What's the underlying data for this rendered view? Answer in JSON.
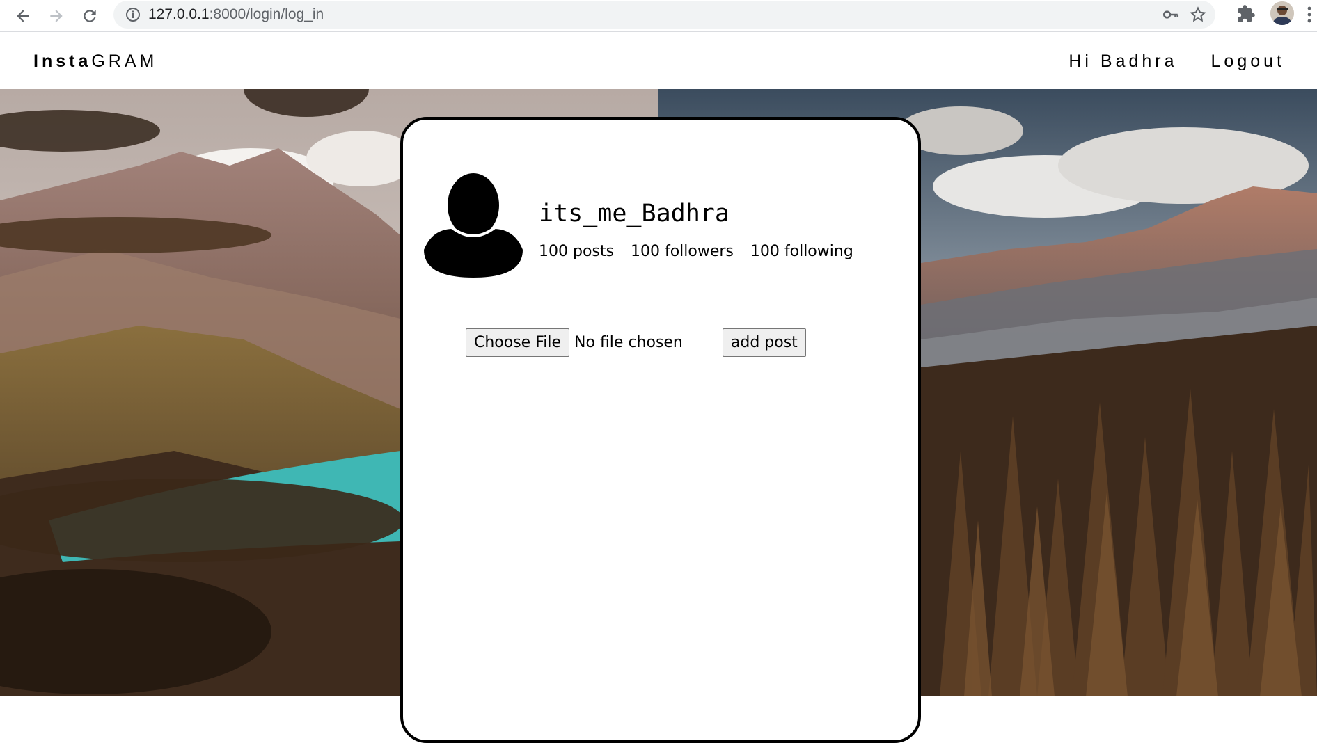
{
  "browser": {
    "url_host": "127.0.0.1",
    "url_path": ":8000/login/log_in",
    "icons": [
      "back-arrow-icon",
      "forward-arrow-icon",
      "reload-icon",
      "info-icon",
      "key-icon",
      "star-icon",
      "puzzle-icon",
      "profile-avatar",
      "menu-dots-icon"
    ]
  },
  "nav": {
    "logo_bold": "Insta",
    "logo_rest": "GRAM",
    "greeting": "Hi Badhra",
    "logout": "Logout"
  },
  "profile": {
    "username": "its_me_Badhra",
    "posts": "100 posts",
    "followers": "100 followers",
    "following": "100 following"
  },
  "upload": {
    "choose_file_label": "Choose File",
    "file_status": "No file chosen",
    "add_post_label": "add post"
  },
  "colors": {
    "card_border": "#000000",
    "card_bg": "#ffffff",
    "button_bg": "#efefef",
    "sky": "#c9c4c0",
    "forest": "#4a3320"
  }
}
